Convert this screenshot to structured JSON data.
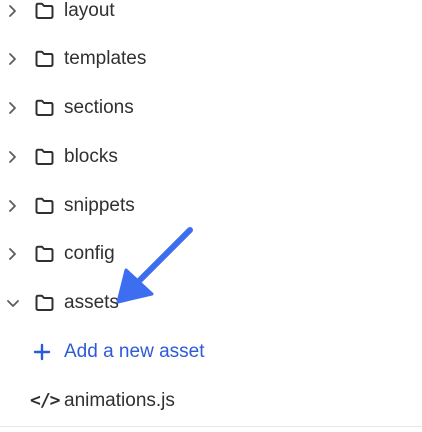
{
  "tree": {
    "folders": [
      {
        "label": "layout",
        "expanded": false
      },
      {
        "label": "templates",
        "expanded": false
      },
      {
        "label": "sections",
        "expanded": false
      },
      {
        "label": "blocks",
        "expanded": false
      },
      {
        "label": "snippets",
        "expanded": false
      },
      {
        "label": "config",
        "expanded": false
      },
      {
        "label": "assets",
        "expanded": true
      }
    ],
    "add_asset_label": "Add a new asset",
    "files": [
      {
        "icon": "</>",
        "label": "animations.js"
      }
    ]
  },
  "colors": {
    "text": "#303030",
    "accent": "#2d5bd7",
    "arrow": "#3d6ef0"
  },
  "icons": {
    "chevron_collapsed": "chevron-right-icon",
    "chevron_expanded": "chevron-down-icon",
    "folder": "folder-icon",
    "add": "plus-icon",
    "code_file": "code-file-icon",
    "annotation": "arrow-annotation-icon"
  }
}
